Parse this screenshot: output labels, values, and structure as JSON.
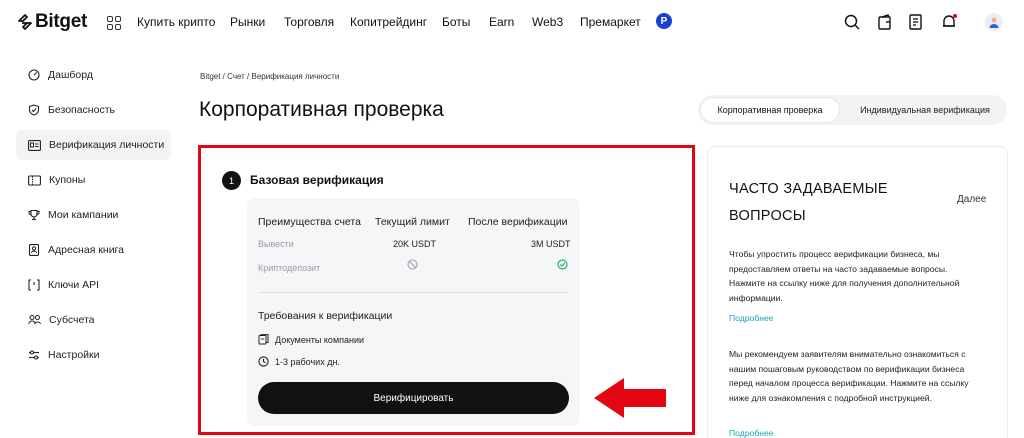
{
  "header": {
    "logo_text": "Bitget",
    "nav": [
      "Купить крипто",
      "Рынки",
      "Торговля",
      "Копитрейдинг",
      "Боты",
      "Earn",
      "Web3",
      "Премаркет"
    ],
    "badge": "P",
    "icons": [
      "search-icon",
      "wallet-icon",
      "orders-icon",
      "bell-icon",
      "avatar"
    ]
  },
  "sidebar": {
    "items": [
      {
        "label": "Дашборд",
        "icon": "dashboard-icon"
      },
      {
        "label": "Безопасность",
        "icon": "shield-icon"
      },
      {
        "label": "Верификация личности",
        "icon": "id-card-icon",
        "active": true
      },
      {
        "label": "Купоны",
        "icon": "coupon-icon"
      },
      {
        "label": "Мои кампании",
        "icon": "trophy-icon"
      },
      {
        "label": "Адресная книга",
        "icon": "address-book-icon"
      },
      {
        "label": "Ключи API",
        "icon": "api-icon"
      },
      {
        "label": "Субсчета",
        "icon": "subaccounts-icon"
      },
      {
        "label": "Настройки",
        "icon": "settings-icon"
      }
    ]
  },
  "main": {
    "breadcrumb": "Bitget / Счет / Верификация личности",
    "title": "Корпоративная проверка",
    "tabs": [
      "Корпоративная проверка",
      "Индивидуальная верификация"
    ],
    "step_number": "1",
    "step_title": "Базовая верификация",
    "table": {
      "headers": [
        "Преимущества счета",
        "Текущий лимит",
        "После верификации"
      ],
      "rows": [
        {
          "label": "Вывести",
          "current": "20K USDT",
          "after": "3M USDT"
        },
        {
          "label": "Криптодепозит",
          "current_icon": "forbidden-icon",
          "after_icon": "check-circle-icon"
        }
      ]
    },
    "requirements_title": "Требования к верификации",
    "requirements": [
      {
        "icon": "documents-icon",
        "text": "Документы компании"
      },
      {
        "icon": "clock-icon",
        "text": "1-3 рабочих дн."
      }
    ],
    "verify_button": "Верифицировать",
    "highlight_color": "#e30613"
  },
  "faq": {
    "title": "ЧАСТО ЗАДАВАЕМЫЕ ВОПРОСЫ",
    "more": "Далее",
    "items": [
      {
        "text": "Чтобы упростить процесс верификации бизнеса, мы предоставляем ответы на часто задаваемые вопросы. Нажмите на ссылку ниже для получения дополнительной информации.",
        "link": "Подробнее"
      },
      {
        "text": "Мы рекомендуем заявителям внимательно ознакомиться с нашим пошаговым руководством по верификации бизнеса перед началом процесса верификации. Нажмите на ссылку ниже для ознакомления с подробной инструкцией.",
        "link": "Подробнее"
      }
    ]
  }
}
